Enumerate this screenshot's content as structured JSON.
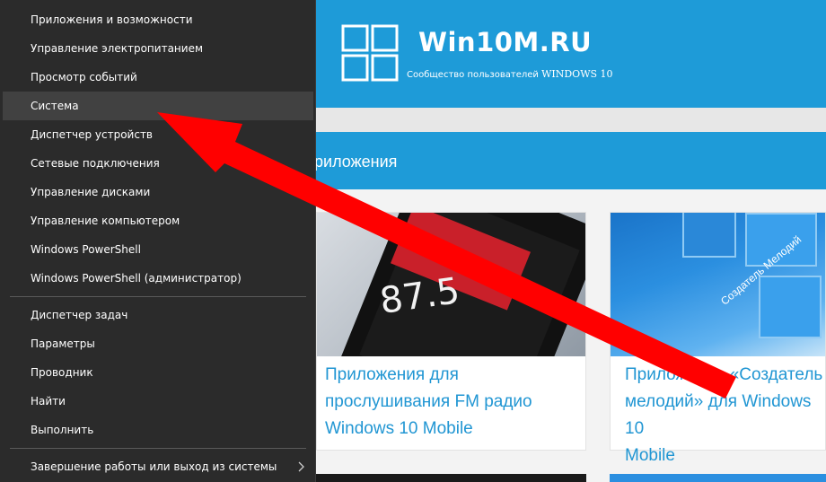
{
  "site": {
    "logo_title": "Win10M.RU",
    "logo_subtitle_a": "Сообщество пользователей",
    "logo_subtitle_b": "WINDOWS 10",
    "section_title": "риложения",
    "articles": [
      {
        "title": "Приложения для\nпрослушивания FM радио\nWindows 10 Mobile",
        "image_text": "87.5"
      },
      {
        "title": "Приложение «Создатель\nмелодий» для Windows 10\nMobile",
        "image_text": "Создатель Мелодий"
      }
    ],
    "colors": {
      "brand_blue": "#1e9bd8",
      "link_blue": "#2196d3"
    }
  },
  "menu": {
    "group1": [
      "Приложения и возможности",
      "Управление электропитанием",
      "Просмотр событий",
      "Система",
      "Диспетчер устройств",
      "Сетевые подключения",
      "Управление дисками",
      "Управление компьютером",
      "Windows PowerShell",
      "Windows PowerShell (администратор)"
    ],
    "group2": [
      "Диспетчер задач",
      "Параметры",
      "Проводник",
      "Найти",
      "Выполнить"
    ],
    "group3": [
      "Завершение работы или выход из системы"
    ],
    "highlighted": "Система",
    "submenu_icon": "chevron-right-icon",
    "colors": {
      "background": "#2b2b2b",
      "highlight": "#414141",
      "text": "#ffffff"
    }
  },
  "annotation": {
    "color": "#ff0000",
    "icon": "red-arrow-pointer"
  }
}
